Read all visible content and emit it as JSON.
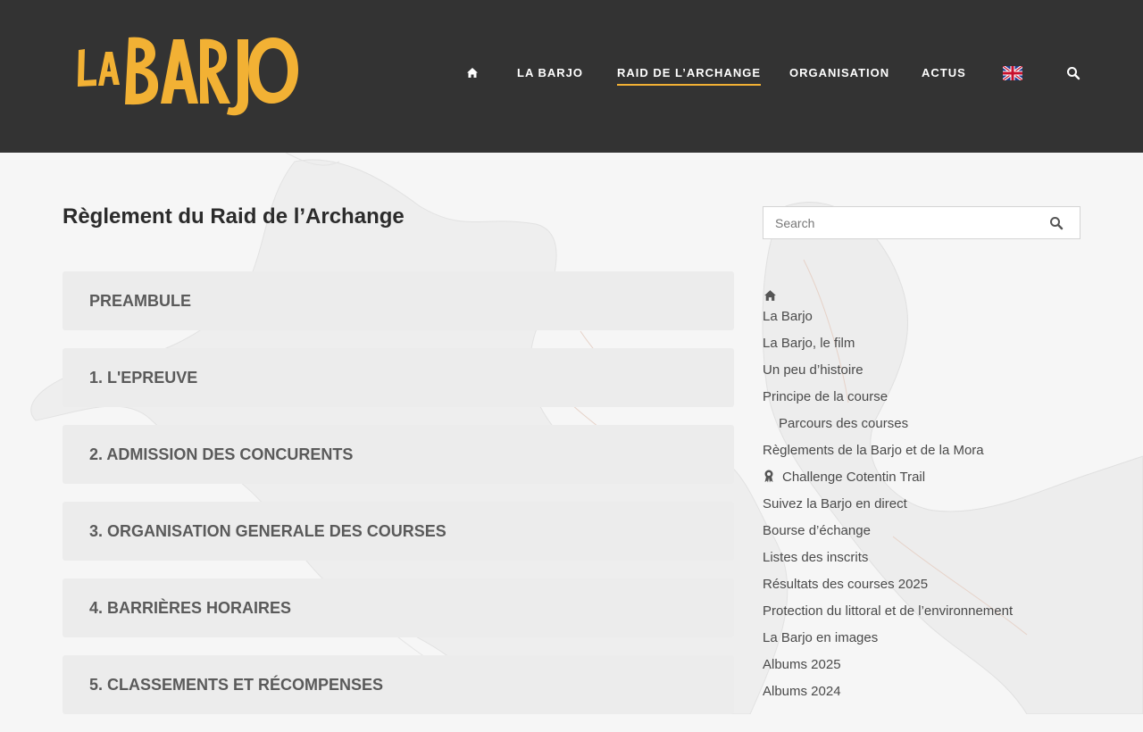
{
  "brand": {
    "name": "LA BARJO",
    "logo_text_small": "LA",
    "logo_text_big": "BARJO",
    "accent_color": "#f2b134",
    "header_bg": "#333333"
  },
  "nav": {
    "home_icon": "home-icon",
    "items": [
      {
        "label": "LA BARJO",
        "active": false
      },
      {
        "label": "RAID DE L’ARCHANGE",
        "active": true
      },
      {
        "label": "ORGANISATION",
        "active": false
      },
      {
        "label": "ACTUS",
        "active": false
      }
    ],
    "language_icon": "uk-flag-icon",
    "search_icon": "search-icon"
  },
  "page": {
    "title": "Règlement du Raid de l’Archange"
  },
  "accordion": {
    "sections": [
      "PREAMBULE",
      "1. L'EPREUVE",
      "2. ADMISSION DES CONCURENTS",
      "3. ORGANISATION GENERALE DES COURSES",
      "4. BARRIÈRES HORAIRES",
      "5. CLASSEMENTS ET RÉCOMPENSES"
    ]
  },
  "sidebar": {
    "search": {
      "placeholder": "Search",
      "icon": "search-icon"
    },
    "menu": {
      "home_icon": "home-icon",
      "items": [
        {
          "label": "La Barjo"
        },
        {
          "label": "La Barjo, le film"
        },
        {
          "label": "Un peu d’histoire"
        },
        {
          "label": "Principe de la course"
        },
        {
          "label": "Parcours des courses"
        },
        {
          "label": "Règlements de la Barjo et de la Mora"
        },
        {
          "label": "Challenge Cotentin Trail",
          "icon": "award-ribbon-icon"
        },
        {
          "label": "Suivez la Barjo en direct"
        },
        {
          "label": "Bourse d’échange"
        },
        {
          "label": "Listes des inscrits"
        },
        {
          "label": "Résultats des courses 2025"
        },
        {
          "label": "Protection du littoral et de l’environnement"
        },
        {
          "label": "La Barjo en images"
        },
        {
          "label": "Albums 2025"
        },
        {
          "label": "Albums 2024"
        }
      ]
    }
  }
}
